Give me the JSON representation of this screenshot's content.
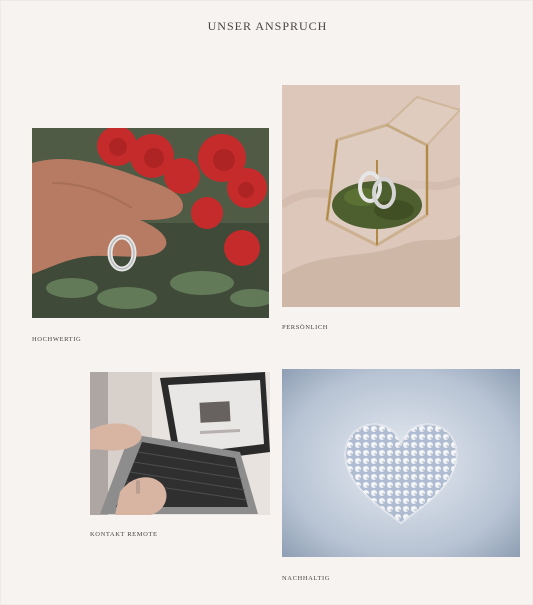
{
  "header": {
    "title": "UNSER ANSPRUCH",
    "subtitle": ""
  },
  "cards": [
    {
      "id": "hochwertig",
      "title": "HOCHWERTIG",
      "text": ""
    },
    {
      "id": "persoenlich",
      "title": "PERSÖNLICH",
      "text": ""
    },
    {
      "id": "kontakt",
      "title": "KONTAKT REMOTE",
      "text": ""
    },
    {
      "id": "nachhaltig",
      "title": "NACHHALTIG",
      "text": ""
    }
  ],
  "colors": {
    "background": "#f6f3f1",
    "text_dark": "#4a4444",
    "text_muted": "#7f7875"
  }
}
